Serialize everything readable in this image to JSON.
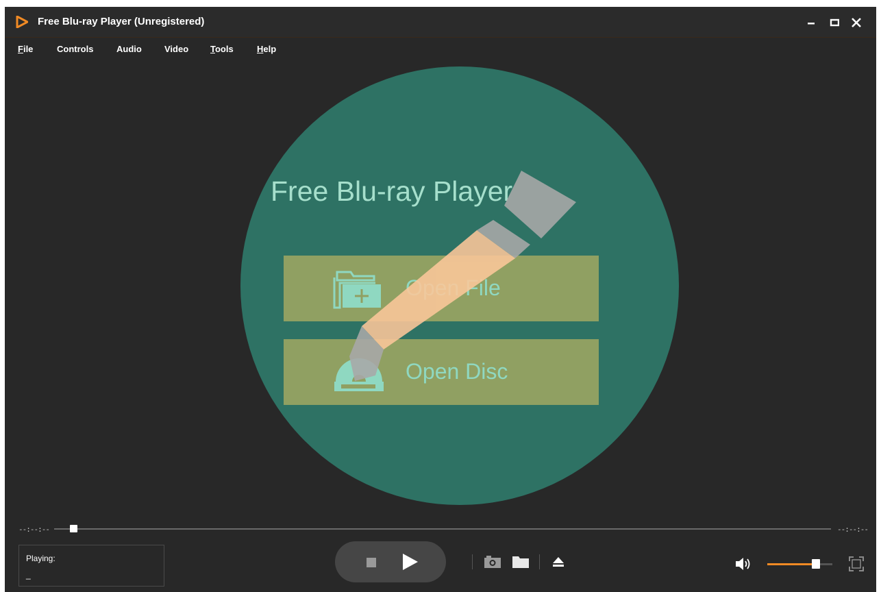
{
  "window": {
    "title": "Free Blu-ray Player (Unregistered)",
    "controls": {
      "minimize_icon": "minimize-icon",
      "maximize_icon": "maximize-icon",
      "close_icon": "close-icon"
    }
  },
  "menu": [
    {
      "mnemonic": "F",
      "rest": "ile"
    },
    {
      "mnemonic": "",
      "rest": "Controls"
    },
    {
      "mnemonic": "",
      "rest": "Audio"
    },
    {
      "mnemonic": "",
      "rest": "Video"
    },
    {
      "mnemonic": "T",
      "rest": "ools"
    },
    {
      "mnemonic": "H",
      "rest": "elp"
    }
  ],
  "hero": {
    "title": "Free Blu-ray Player",
    "open_file_label": "Open File",
    "open_disc_label": "Open Disc",
    "open_file_icon": "folder-add-icon",
    "open_disc_icon": "disc-icon",
    "overlay_icon": "pencil-icon"
  },
  "playback": {
    "time_left": "--:--:--",
    "time_right": "--:--:--",
    "progress": 0.02,
    "playing_label": "Playing:",
    "playing_value": "_"
  },
  "controls": {
    "stop_icon": "stop-icon",
    "play_icon": "play-icon",
    "snapshot_icon": "camera-icon",
    "folder_icon": "folder-icon",
    "eject_icon": "eject-icon",
    "volume_icon": "speaker-icon",
    "volume_level": 0.75,
    "fullscreen_icon": "fullscreen-icon"
  },
  "colors": {
    "accent": "#f08a24",
    "background": "#282828",
    "circle": "#2e7264",
    "button": "#90a062",
    "text_teal": "#8fd8c1",
    "pencil_gray": "#a9a9a9",
    "pencil_peach": "#fcc79a"
  }
}
